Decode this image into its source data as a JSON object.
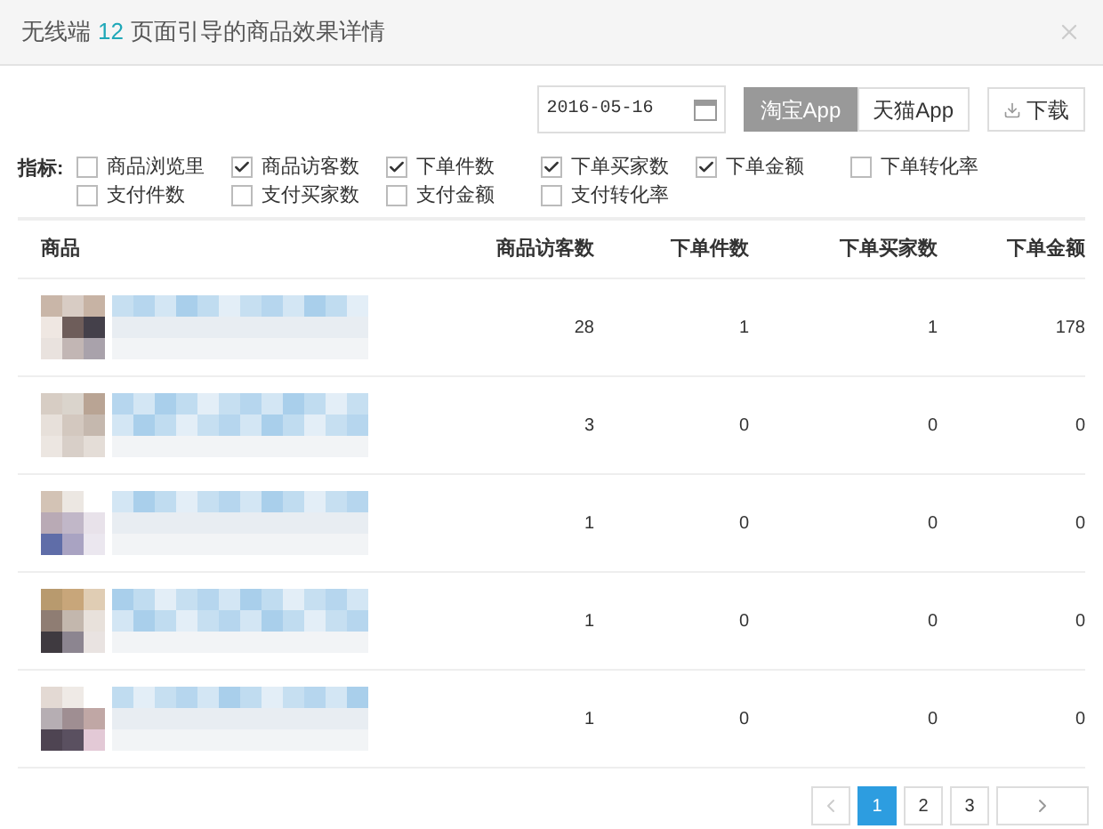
{
  "dialog": {
    "title_prefix": "无线端",
    "title_count": "12",
    "title_suffix": "页面引导的商品效果详情"
  },
  "toolbar": {
    "date": "2016-05-16",
    "app_tabs": [
      {
        "label": "淘宝App",
        "selected": true
      },
      {
        "label": "天猫App",
        "selected": false
      }
    ],
    "download": "下载"
  },
  "metrics": {
    "label": "指标:",
    "rows": [
      [
        {
          "label": "商品浏览里",
          "checked": false
        },
        {
          "label": "商品访客数",
          "checked": true
        },
        {
          "label": "下单件数",
          "checked": true
        },
        {
          "label": "下单买家数",
          "checked": true
        },
        {
          "label": "下单金额",
          "checked": true
        },
        {
          "label": "下单转化率",
          "checked": false
        }
      ],
      [
        {
          "label": "支付件数",
          "checked": false
        },
        {
          "label": "支付买家数",
          "checked": false
        },
        {
          "label": "支付金额",
          "checked": false
        },
        {
          "label": "支付转化率",
          "checked": false
        }
      ]
    ]
  },
  "table": {
    "columns": [
      "商品",
      "商品访客数",
      "下单件数",
      "下单买家数",
      "下单金额"
    ],
    "rows": [
      {
        "cells": [
          {
            "kind": "picture"
          },
          "28",
          "1",
          "1",
          "178"
        ]
      },
      {
        "cells": [
          {
            "kind": "picture"
          },
          "3",
          "0",
          "0",
          "0"
        ]
      },
      {
        "cells": [
          {
            "kind": "picture"
          },
          "1",
          "0",
          "0",
          "0"
        ]
      },
      {
        "cells": [
          {
            "kind": "picture"
          },
          "1",
          "0",
          "0",
          "0"
        ]
      },
      {
        "cells": [
          {
            "kind": "picture"
          },
          "1",
          "0",
          "0",
          "0"
        ]
      }
    ]
  },
  "pagination": {
    "pages": [
      {
        "label": "1",
        "selected": true
      },
      {
        "label": "2",
        "selected": false
      },
      {
        "label": "3",
        "selected": false
      }
    ]
  }
}
